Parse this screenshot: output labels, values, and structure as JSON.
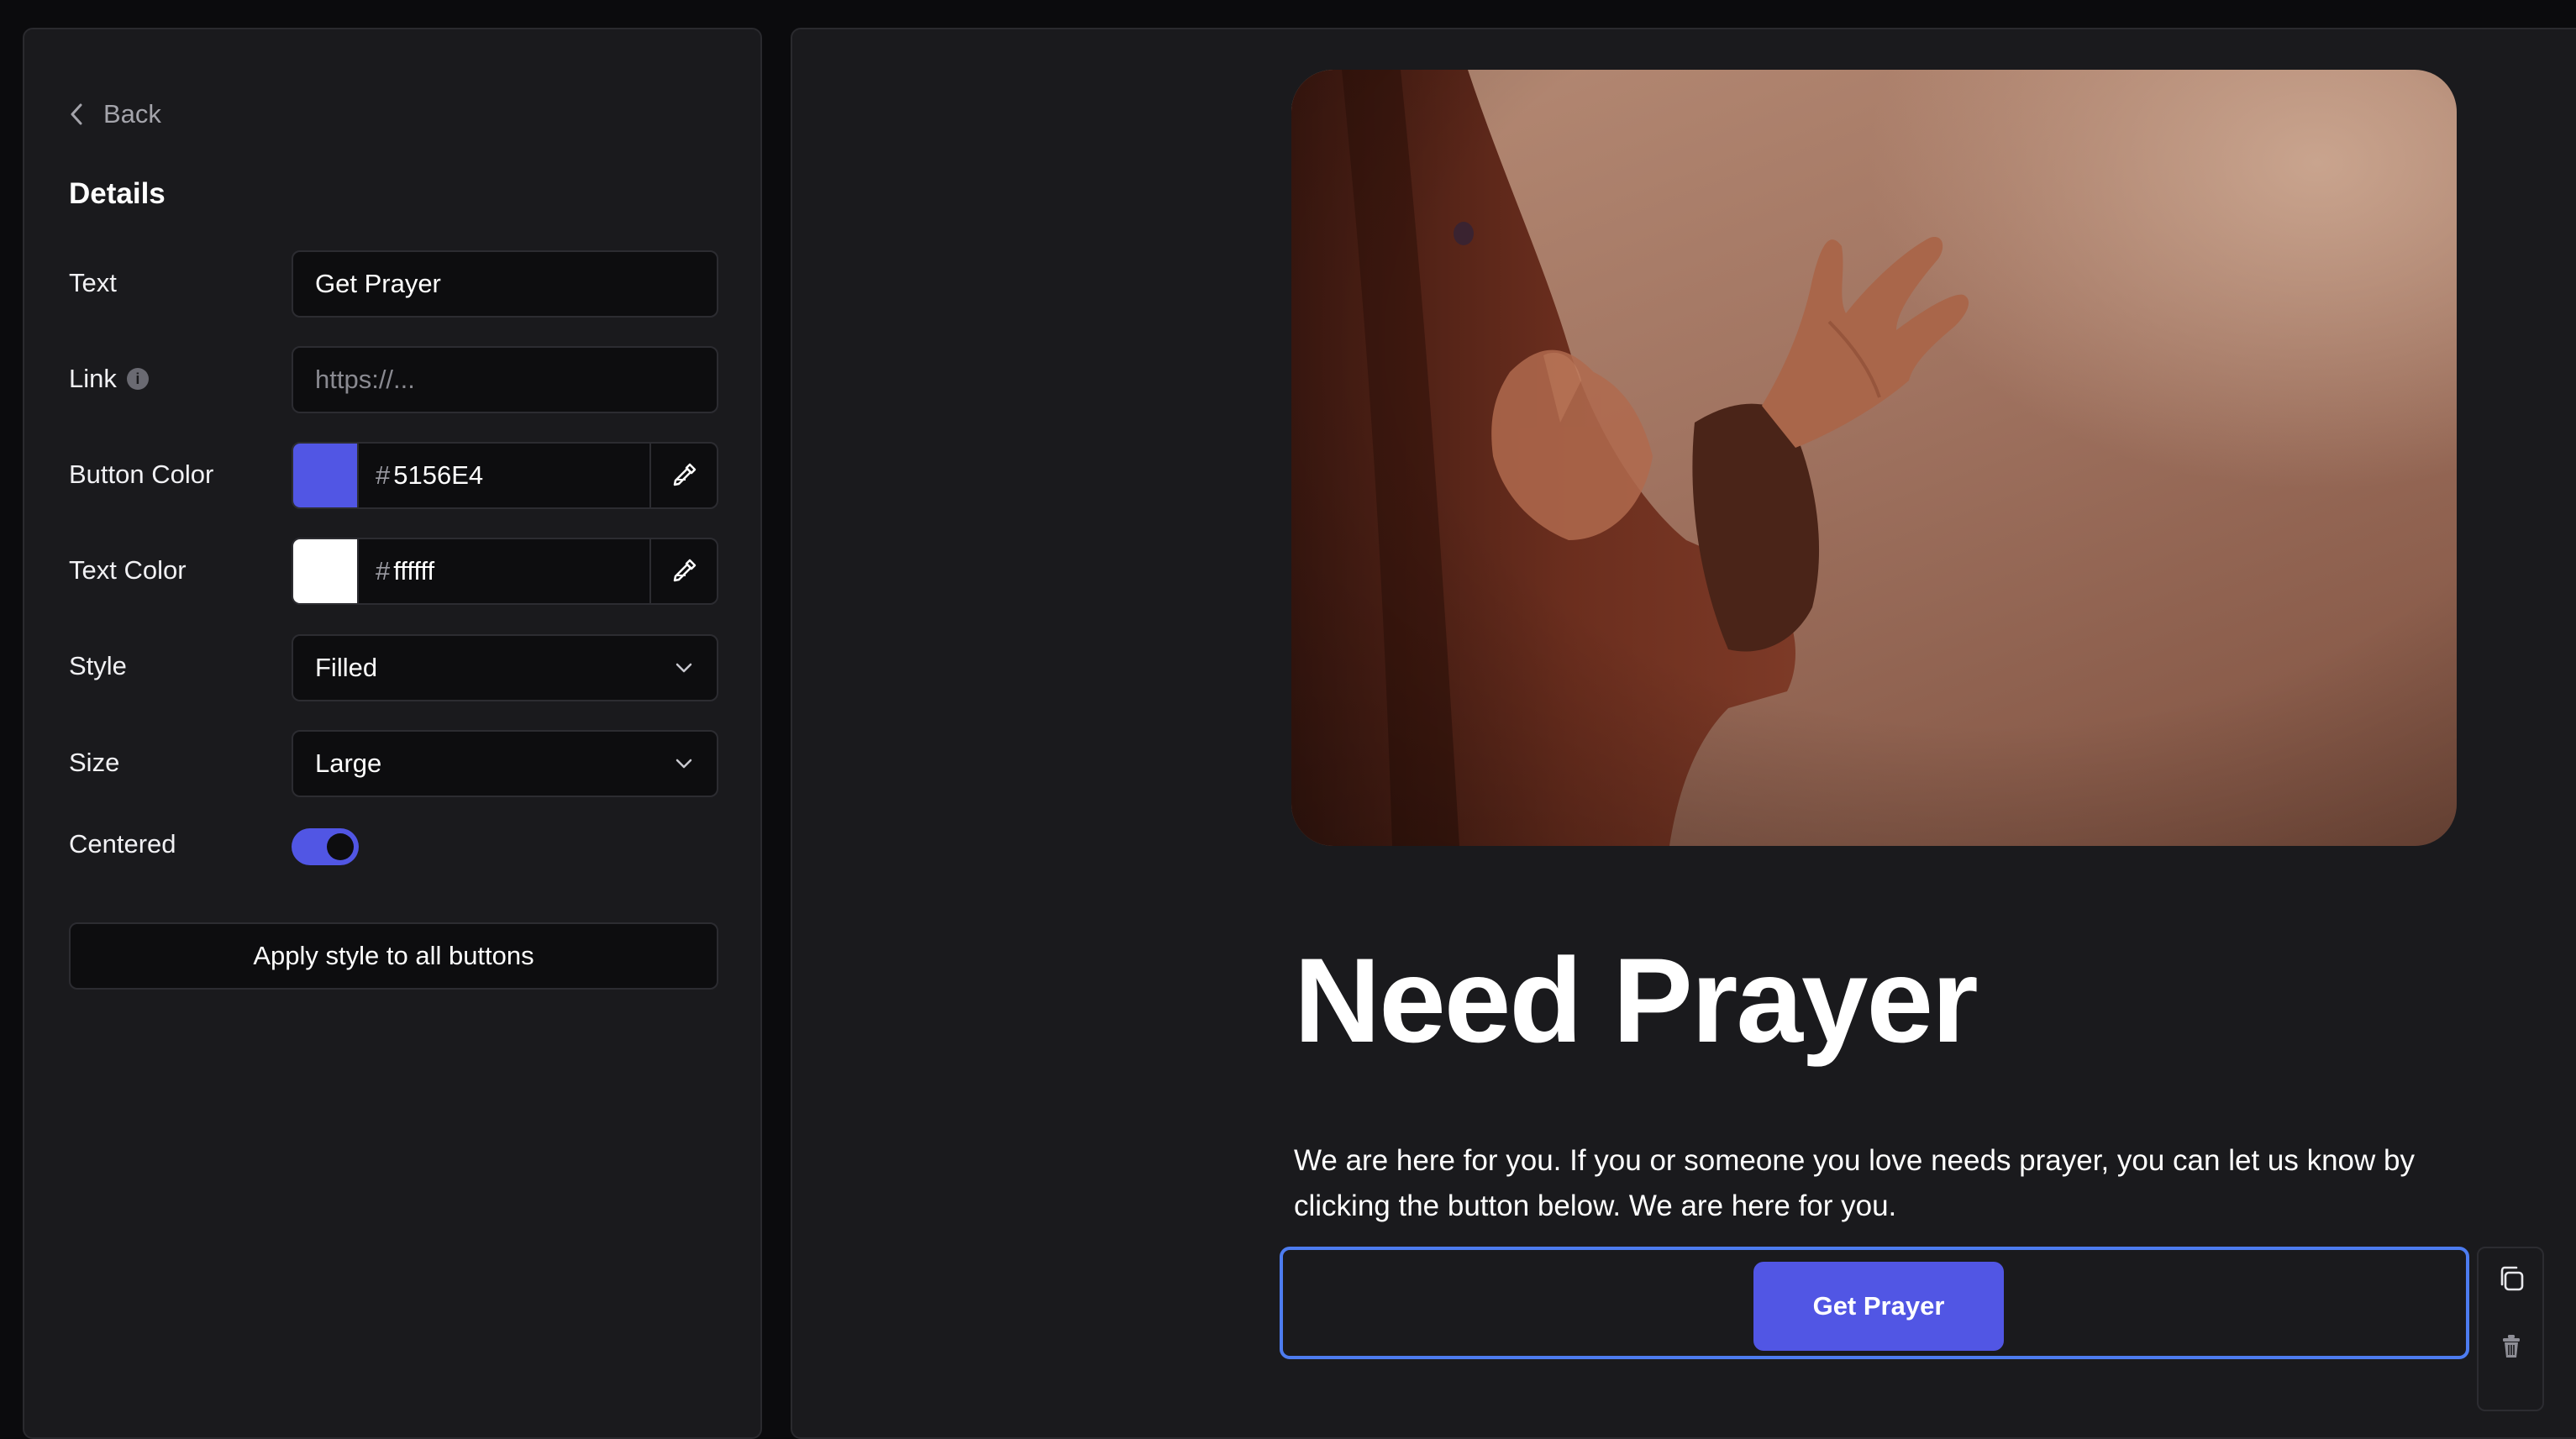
{
  "sidebar": {
    "back_label": "Back",
    "section_title": "Details",
    "fields": {
      "text": {
        "label": "Text",
        "value": "Get Prayer"
      },
      "link": {
        "label": "Link",
        "value": "",
        "placeholder": "https://..."
      },
      "button_color": {
        "label": "Button Color",
        "hash": "#",
        "value": "5156E4",
        "swatch": "#5156e4"
      },
      "text_color": {
        "label": "Text Color",
        "hash": "#",
        "value": "ffffff",
        "swatch": "#ffffff"
      },
      "style": {
        "label": "Style",
        "value": "Filled"
      },
      "size": {
        "label": "Size",
        "value": "Large"
      },
      "centered": {
        "label": "Centered",
        "on": true
      }
    },
    "apply_label": "Apply style to all buttons"
  },
  "canvas": {
    "headline": "Need Prayer",
    "body": "We are here for you. If you or someone you love needs prayer, you can let us know by clicking the button below. We are here for you.",
    "cta_label": "Get Prayer"
  },
  "icons": {
    "back": "chevron-left-icon",
    "info": "info-icon",
    "eyedropper": "eyedropper-icon",
    "dropdown": "chevron-down-icon",
    "duplicate": "copy-icon",
    "delete": "trash-icon"
  },
  "colors": {
    "accent": "#5156e4",
    "selection": "#4d7cf0",
    "panel": "#1a1a1d",
    "background": "#0b0b0d"
  }
}
